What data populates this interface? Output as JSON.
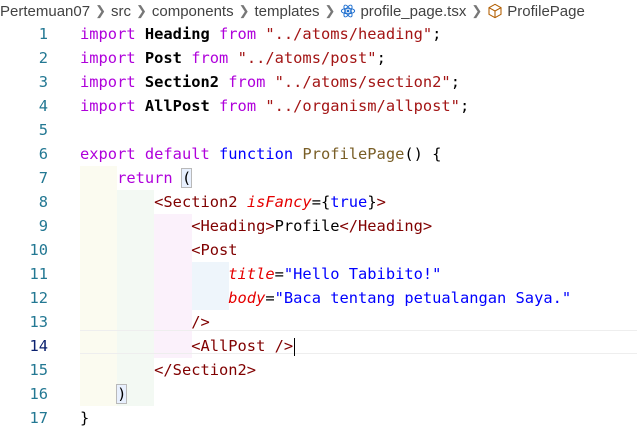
{
  "breadcrumb": {
    "project": "Pertemuan07",
    "folder1": "src",
    "folder2": "components",
    "folder3": "templates",
    "file": "profile_page.tsx",
    "symbol": "ProfilePage"
  },
  "lines": [
    {
      "n": "1",
      "tokens": [
        [
          "imp",
          "import "
        ],
        [
          "id",
          "Heading"
        ],
        [
          "imp",
          " from "
        ],
        [
          "str",
          "\"../atoms/heading\""
        ],
        [
          "pun",
          ";"
        ]
      ]
    },
    {
      "n": "2",
      "tokens": [
        [
          "imp",
          "import "
        ],
        [
          "id",
          "Post"
        ],
        [
          "imp",
          " from "
        ],
        [
          "str",
          "\"../atoms/post\""
        ],
        [
          "pun",
          ";"
        ]
      ]
    },
    {
      "n": "3",
      "tokens": [
        [
          "imp",
          "import "
        ],
        [
          "id",
          "Section2"
        ],
        [
          "imp",
          " from "
        ],
        [
          "str",
          "\"../atoms/section2\""
        ],
        [
          "pun",
          ";"
        ]
      ]
    },
    {
      "n": "4",
      "tokens": [
        [
          "imp",
          "import "
        ],
        [
          "id",
          "AllPost"
        ],
        [
          "imp",
          " from "
        ],
        [
          "str",
          "\"../organism/allpost\""
        ],
        [
          "pun",
          ";"
        ]
      ]
    },
    {
      "n": "5",
      "tokens": []
    },
    {
      "n": "6",
      "tokens": [
        [
          "imp",
          "export "
        ],
        [
          "imp",
          "default "
        ],
        [
          "kw",
          "function "
        ],
        [
          "fn",
          "ProfilePage"
        ],
        [
          "pun",
          "() {"
        ]
      ]
    },
    {
      "n": "7",
      "tokens": [
        [
          "pun",
          "    "
        ],
        [
          "imp",
          "return "
        ],
        [
          "bracket",
          "("
        ]
      ]
    },
    {
      "n": "8",
      "tokens": [
        [
          "pun",
          "        "
        ],
        [
          "tag",
          "<Section2 "
        ],
        [
          "attr",
          "isFancy"
        ],
        [
          "pun",
          "="
        ],
        [
          "pun",
          "{"
        ],
        [
          "attrv",
          "true"
        ],
        [
          "pun",
          "}"
        ],
        [
          "tag",
          ">"
        ]
      ]
    },
    {
      "n": "9",
      "tokens": [
        [
          "pun",
          "            "
        ],
        [
          "tag",
          "<Heading>"
        ],
        [
          "pun",
          "Profile"
        ],
        [
          "tag",
          "</Heading>"
        ]
      ]
    },
    {
      "n": "10",
      "tokens": [
        [
          "pun",
          "            "
        ],
        [
          "tag",
          "<Post"
        ]
      ]
    },
    {
      "n": "11",
      "tokens": [
        [
          "pun",
          "                "
        ],
        [
          "attr",
          "title"
        ],
        [
          "pun",
          "="
        ],
        [
          "attrv",
          "\"Hello Tabibito!\""
        ]
      ]
    },
    {
      "n": "12",
      "tokens": [
        [
          "pun",
          "                "
        ],
        [
          "attr",
          "body"
        ],
        [
          "pun",
          "="
        ],
        [
          "attrv",
          "\"Baca tentang petualangan Saya.\""
        ]
      ]
    },
    {
      "n": "13",
      "tokens": [
        [
          "pun",
          "            "
        ],
        [
          "tag",
          "/>"
        ]
      ]
    },
    {
      "n": "14",
      "tokens": [
        [
          "pun",
          "            "
        ],
        [
          "tag",
          "<AllPost />"
        ],
        [
          "cursor",
          ""
        ]
      ]
    },
    {
      "n": "15",
      "tokens": [
        [
          "pun",
          "        "
        ],
        [
          "tag",
          "</Section2>"
        ]
      ]
    },
    {
      "n": "16",
      "tokens": [
        [
          "pun",
          "    "
        ],
        [
          "bracket",
          ")"
        ]
      ]
    },
    {
      "n": "17",
      "tokens": [
        [
          "pun",
          "}"
        ]
      ]
    }
  ],
  "active_line": "14"
}
